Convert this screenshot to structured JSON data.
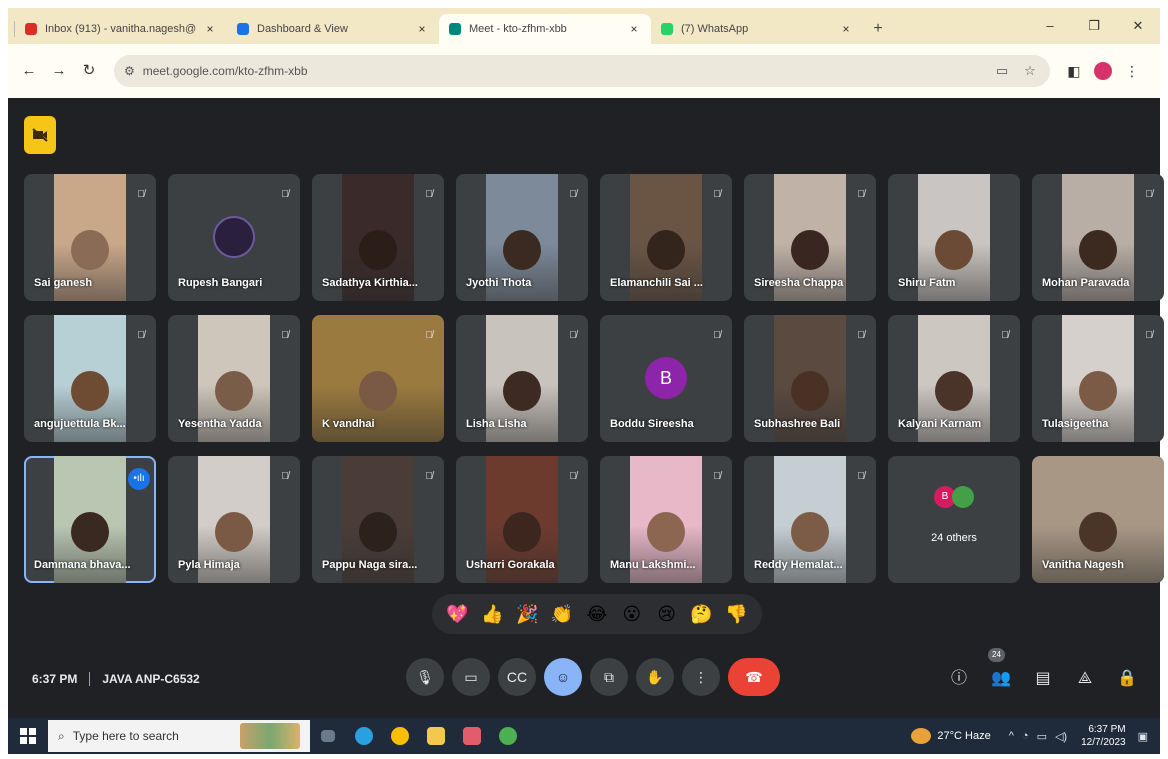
{
  "browser": {
    "tabs": [
      {
        "title": "Inbox (913) - vanitha.nagesh@",
        "favicon_color": "#d93025",
        "active": false
      },
      {
        "title": "Dashboard & View",
        "favicon_color": "#1a73e8",
        "active": false
      },
      {
        "title": "Meet - kto-zfhm-xbb",
        "favicon_color": "#00897b",
        "active": true
      },
      {
        "title": "(7) WhatsApp",
        "favicon_color": "#25d366",
        "active": false
      }
    ],
    "address": "meet.google.com/kto-zfhm-xbb"
  },
  "meet": {
    "time": "6:37 PM",
    "meeting_name": "JAVA ANP-C6532",
    "tiles": [
      {
        "name": "Sai ganesh",
        "kind": "video",
        "bg": "#c9a88a",
        "face": "#8a6b55",
        "muted": true
      },
      {
        "name": "Rupesh Bangari",
        "kind": "avatar",
        "avatar_color": "#2a1f3d",
        "avatar_text": "",
        "muted": true
      },
      {
        "name": "Sadathya Kirthia...",
        "kind": "video",
        "bg": "#3a2b2a",
        "face": "#2b1d18",
        "muted": true
      },
      {
        "name": "Jyothi Thota",
        "kind": "video",
        "bg": "#7d8a9a",
        "face": "#3b2a22",
        "muted": true
      },
      {
        "name": "Elamanchili Sai ...",
        "kind": "video",
        "bg": "#6a5545",
        "face": "#33241c",
        "muted": true
      },
      {
        "name": "Sireesha Chappa",
        "kind": "video",
        "bg": "#c0b2a6",
        "face": "#3a2620",
        "muted": true
      },
      {
        "name": "Shiru Fatm",
        "kind": "video",
        "bg": "#c9c5c2",
        "face": "#6b4a36",
        "muted": false
      },
      {
        "name": "Mohan Paravada",
        "kind": "video",
        "bg": "#b8aea6",
        "face": "#3c2a20",
        "muted": true
      },
      {
        "name": "angujuettula Bk...",
        "kind": "video",
        "bg": "#b7d0d6",
        "face": "#6e4b33",
        "muted": true
      },
      {
        "name": "Yesentha Yadda",
        "kind": "video",
        "bg": "#cfc6bb",
        "face": "#7a5d48",
        "muted": true
      },
      {
        "name": "K vandhai",
        "kind": "video-wide",
        "bg": "#9b7a3f",
        "face": "#7b5a45",
        "muted": true
      },
      {
        "name": "Lisha Lisha",
        "kind": "video",
        "bg": "#c9c3bd",
        "face": "#3d2a22",
        "muted": true
      },
      {
        "name": "Boddu Sireesha",
        "kind": "avatar",
        "avatar_color": "#8e24aa",
        "avatar_text": "B",
        "muted": true
      },
      {
        "name": "Subhashree Bali",
        "kind": "video",
        "bg": "#5b4a40",
        "face": "#4a3126",
        "muted": true
      },
      {
        "name": "Kalyani Karnam",
        "kind": "video",
        "bg": "#cdc7c2",
        "face": "#4a3429",
        "muted": true
      },
      {
        "name": "Tulasigeetha",
        "kind": "video",
        "bg": "#d5d0cb",
        "face": "#7b5b45",
        "muted": true
      },
      {
        "name": "Dammana bhava...",
        "kind": "video",
        "bg": "#b8c6b2",
        "face": "#3a2920",
        "muted": false,
        "speaking": true
      },
      {
        "name": "Pyla Himaja",
        "kind": "video",
        "bg": "#d2cdc8",
        "face": "#7a5a44",
        "muted": true
      },
      {
        "name": "Pappu Naga sira...",
        "kind": "video",
        "bg": "#4a3d38",
        "face": "#2d211c",
        "muted": true
      },
      {
        "name": "Usharri Gorakala",
        "kind": "video",
        "bg": "#6d3b2e",
        "face": "#3c261d",
        "muted": true
      },
      {
        "name": "Manu Lakshmi...",
        "kind": "video",
        "bg": "#e6b8c8",
        "face": "#8d6652",
        "muted": true
      },
      {
        "name": "Reddy Hemalat...",
        "kind": "video",
        "bg": "#c5cfd3",
        "face": "#7d5c47",
        "muted": true
      },
      {
        "name": "24 others",
        "kind": "others",
        "muted": false
      },
      {
        "name": "Vanitha Nagesh",
        "kind": "video-wide",
        "bg": "#a89784",
        "face": "#4b3528",
        "muted": false
      }
    ],
    "others_avatars": [
      {
        "letter": "B",
        "color": "#d81b60"
      },
      {
        "letter": "",
        "color": "#43a047"
      }
    ],
    "reactions": [
      "💖",
      "👍",
      "🎉",
      "👏",
      "😂",
      "😮",
      "😢",
      "🤔",
      "👎"
    ],
    "controls": [
      "mic-icon",
      "camera-icon",
      "captions-icon",
      "raise-hand-icon",
      "present-icon",
      "hand-icon",
      "more-icon",
      "end-call-icon"
    ],
    "people_count": "24"
  },
  "taskbar": {
    "search_placeholder": "Type here to search",
    "weather": "27°C Haze",
    "clock_time": "6:37 PM",
    "clock_date": "12/7/2023"
  }
}
